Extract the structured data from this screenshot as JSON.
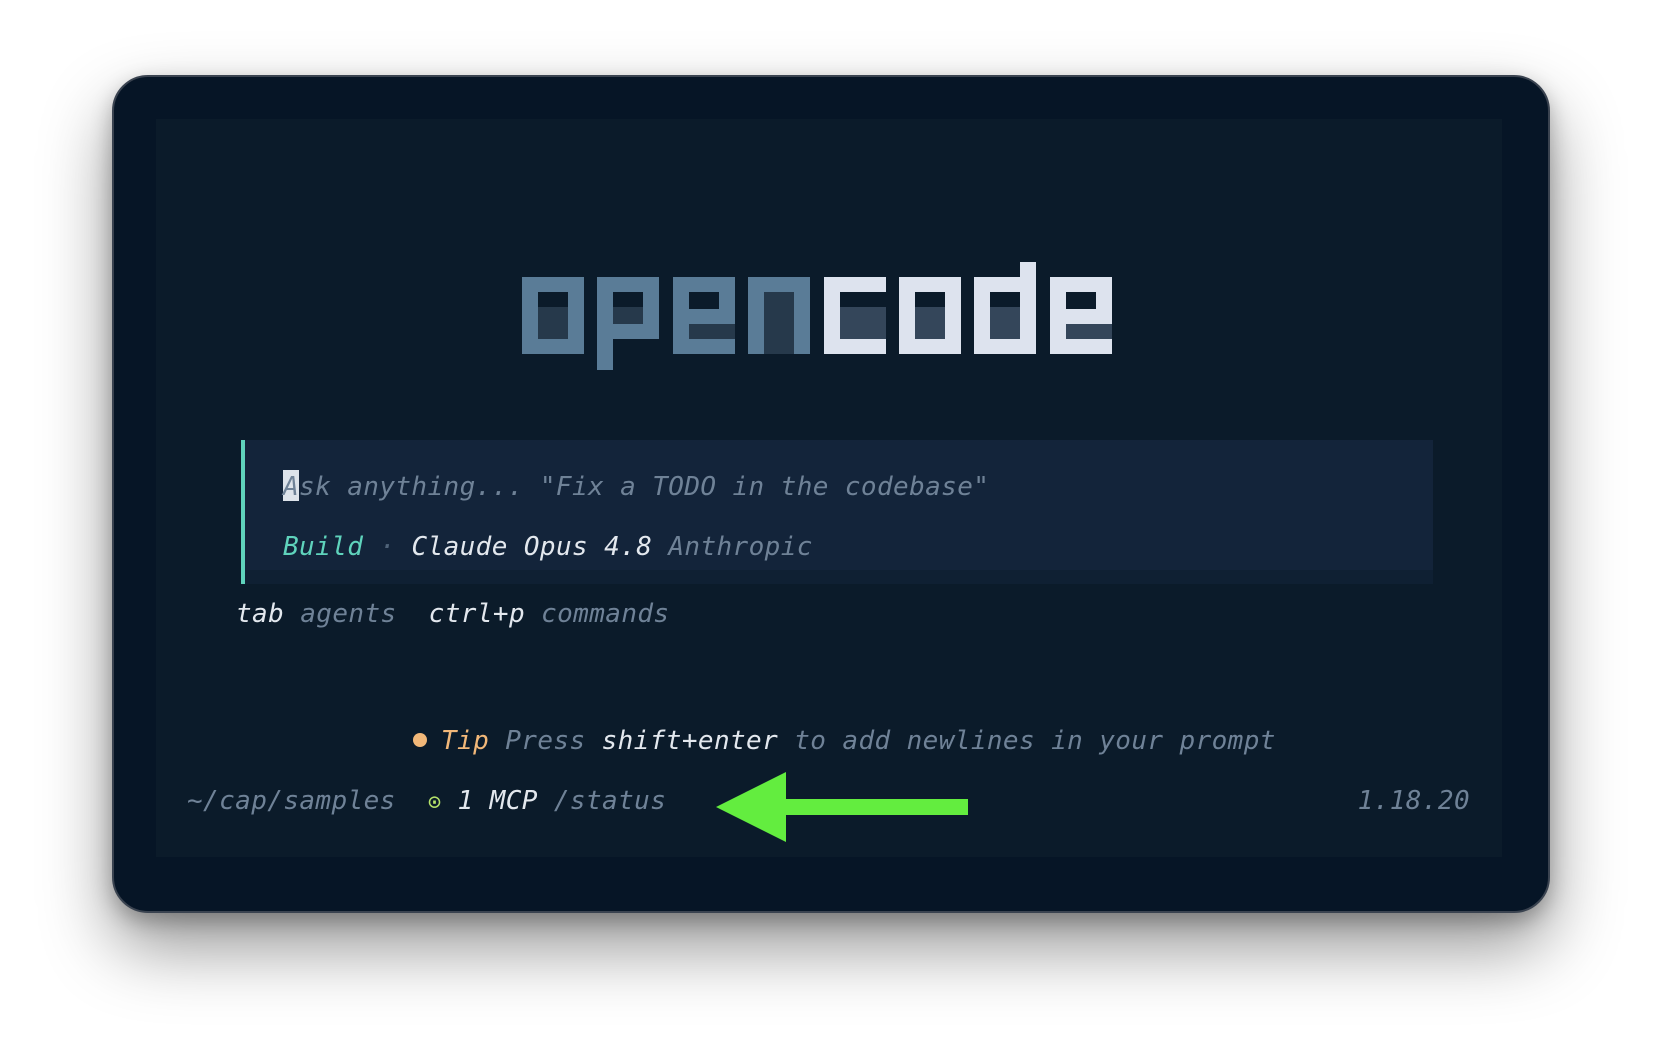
{
  "logo": {
    "part1": "open",
    "part2": "code"
  },
  "prompt": {
    "placeholder": "Ask anything... \"Fix a TODO in the codebase\"",
    "cursor_char": "A",
    "placeholder_rest": "sk anything... \"Fix a TODO in the codebase\""
  },
  "agent": {
    "mode": "Build",
    "separator": "·",
    "model": "Claude Opus 4.8",
    "provider": "Anthropic"
  },
  "hints": [
    {
      "key": "tab",
      "label": "agents"
    },
    {
      "key": "ctrl+p",
      "label": "commands"
    }
  ],
  "tip": {
    "label": "Tip",
    "text_before": "Press",
    "key": "shift+enter",
    "text_after": "to add newlines in your prompt"
  },
  "status": {
    "path": "~/cap/samples",
    "mcp_icon": "⊙",
    "mcp_count": "1 MCP",
    "mcp_command": "/status",
    "version": "1.18.20"
  },
  "colors": {
    "window_bg": "#061526",
    "terminal_bg": "#0b1b2a",
    "prompt_bg": "#13243a",
    "accent_teal": "#5fd3bc",
    "tip_orange": "#f2b879",
    "mcp_green": "#b6e36a",
    "arrow_green": "#63ed3f",
    "logo_dim": "#5a7c97",
    "logo_bright": "#dde3ee"
  }
}
